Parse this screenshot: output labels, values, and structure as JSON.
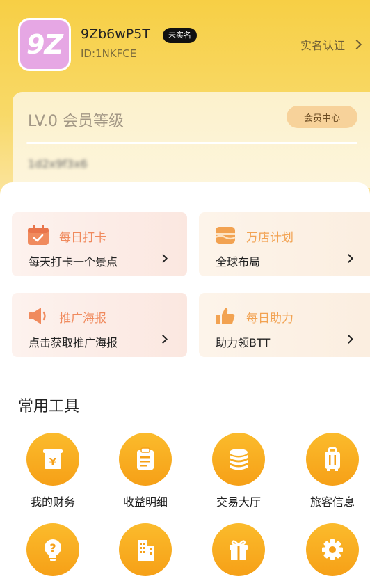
{
  "profile": {
    "avatar_text": "9Z",
    "username": "9Zb6wP5T",
    "badge": "未实名",
    "user_id": "ID:1NKFCE",
    "verify_label": "实名认证"
  },
  "member": {
    "level": "LV.0 会员等级",
    "center_button": "会员中心",
    "progress_text": "1d2x9f3x6"
  },
  "tasks": [
    {
      "title": "每日打卡",
      "subtitle": "每天打卡一个景点",
      "icon": "calendar-check-icon",
      "color": "#f08a5d"
    },
    {
      "title": "万店计划",
      "subtitle": "全球布局",
      "icon": "store-icon",
      "color": "#f2a251"
    },
    {
      "title": "推广海报",
      "subtitle": "点击获取推广海报",
      "icon": "megaphone-icon",
      "color": "#f08a5d"
    },
    {
      "title": "每日助力",
      "subtitle": "助力领BTT",
      "icon": "thumbs-up-icon",
      "color": "#f2a251"
    }
  ],
  "tools": {
    "title": "常用工具",
    "items": [
      {
        "label": "我的财务",
        "icon": "yuan-document-icon"
      },
      {
        "label": "收益明细",
        "icon": "clipboard-icon"
      },
      {
        "label": "交易大厅",
        "icon": "coins-stack-icon"
      },
      {
        "label": "旅客信息",
        "icon": "luggage-icon"
      },
      {
        "label": "",
        "icon": "question-bulb-icon"
      },
      {
        "label": "",
        "icon": "building-icon"
      },
      {
        "label": "",
        "icon": "gift-icon"
      },
      {
        "label": "",
        "icon": "settings-gear-icon"
      }
    ]
  },
  "colors": {
    "brand_yellow": "#f7cf45",
    "tool_orange": "#f6a017",
    "task_red": "#f08a5d",
    "task_orange": "#f2a251"
  }
}
